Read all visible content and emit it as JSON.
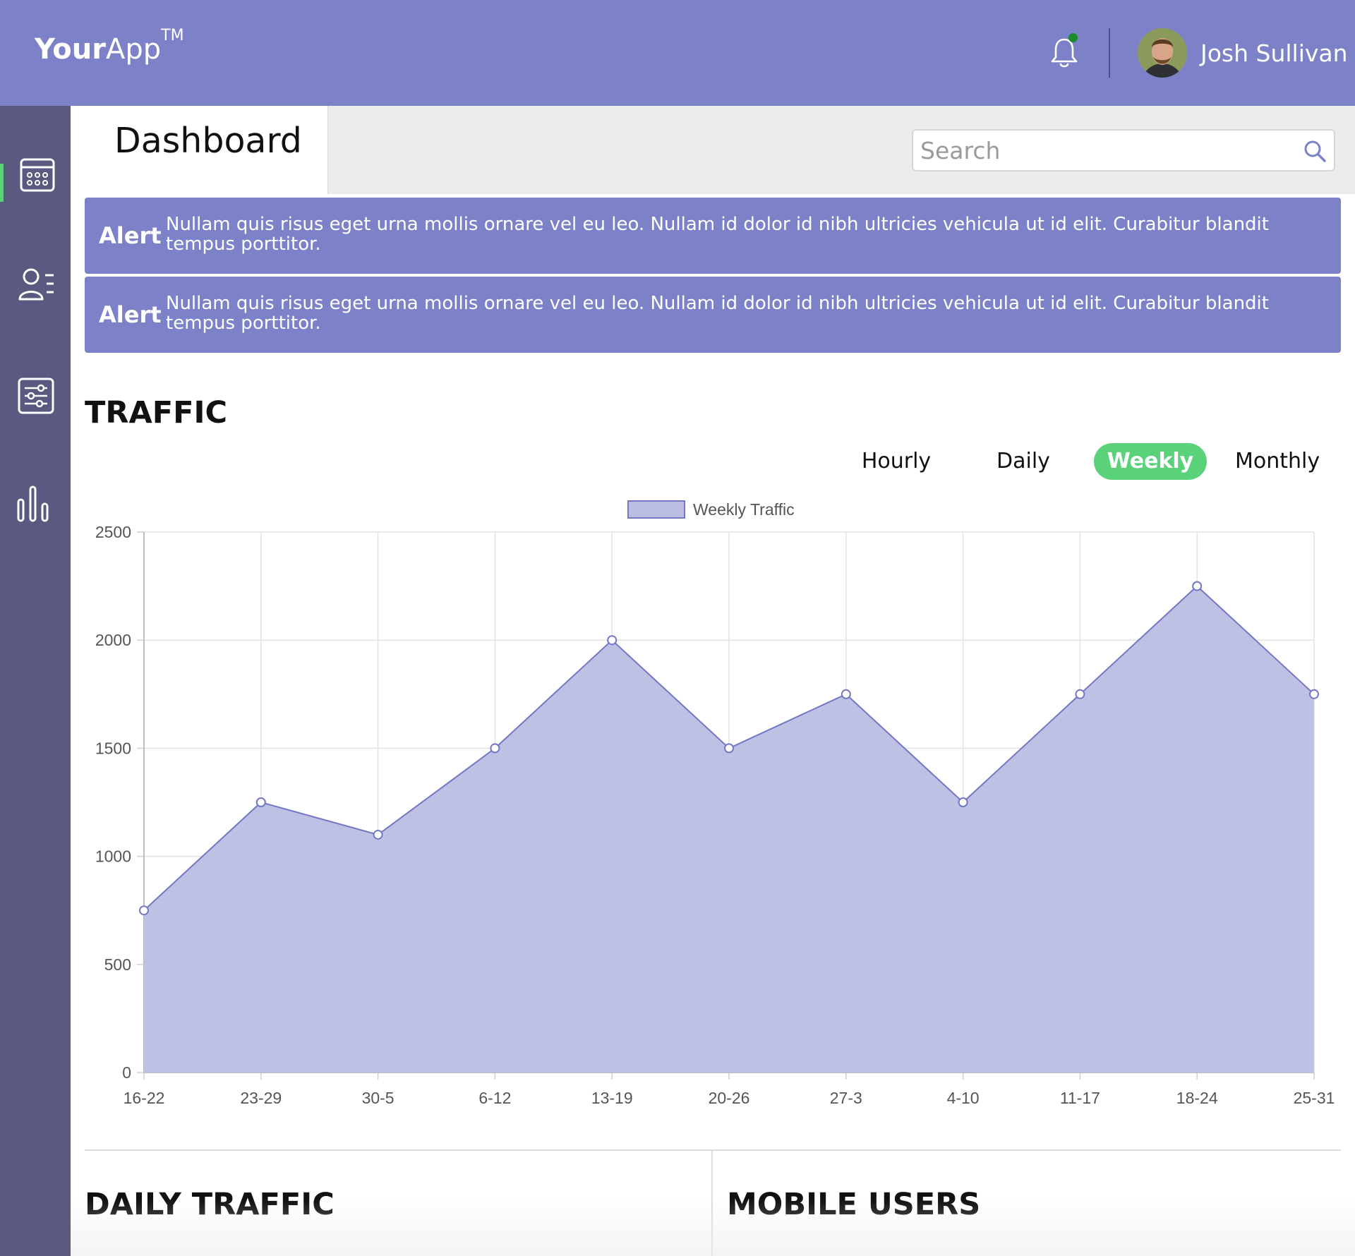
{
  "app": {
    "brand_bold": "Your",
    "brand_light": "App",
    "brand_mark": "TM"
  },
  "header": {
    "user_name": "Josh Sullivan",
    "notification_dot_color": "#1c8d2c",
    "icons": [
      "bell-icon",
      "avatar"
    ]
  },
  "sidebar": {
    "items": [
      {
        "icon": "calendar-icon",
        "active": true
      },
      {
        "icon": "members-icon",
        "active": false
      },
      {
        "icon": "settings-sliders-icon",
        "active": false
      },
      {
        "icon": "bar-chart-icon",
        "active": false
      }
    ]
  },
  "page": {
    "title": "Dashboard",
    "search_placeholder": "Search"
  },
  "alerts": [
    {
      "label": "Alert",
      "text": "Nullam quis risus eget urna mollis ornare vel eu leo. Nullam id dolor id nibh ultricies vehicula ut id elit. Curabitur blandit tempus porttitor.",
      "close": "✕"
    },
    {
      "label": "Alert",
      "text": "Nullam quis risus eget urna mollis ornare vel eu leo. Nullam id dolor id nibh ultricies vehicula ut id elit. Curabitur blandit tempus porttitor.",
      "close": "✕"
    }
  ],
  "traffic": {
    "title": "TRAFFIC",
    "periods": [
      "Hourly",
      "Daily",
      "Weekly",
      "Monthly"
    ],
    "selected_period": "Weekly"
  },
  "colors": {
    "accent": "#7d81c8",
    "sidebar": "#5a5a80",
    "active_green": "#5ad27a",
    "chart_fill": "#bbbde3",
    "chart_line": "#7377c4"
  },
  "chart_data": {
    "type": "area",
    "categories": [
      "16-22",
      "23-29",
      "30-5",
      "6-12",
      "13-19",
      "20-26",
      "27-3",
      "4-10",
      "11-17",
      "18-24",
      "25-31"
    ],
    "series": [
      {
        "name": "Weekly Traffic",
        "values": [
          750,
          1250,
          1100,
          1500,
          2000,
          1500,
          1750,
          1250,
          1750,
          2250,
          1750
        ]
      }
    ],
    "yticks": [
      0,
      500,
      1000,
      1500,
      2000,
      2500
    ],
    "ylim": [
      0,
      2500
    ],
    "grid": true,
    "legend": "top-center"
  },
  "bottom": {
    "left_title": "DAILY TRAFFIC",
    "right_title": "MOBILE USERS"
  }
}
